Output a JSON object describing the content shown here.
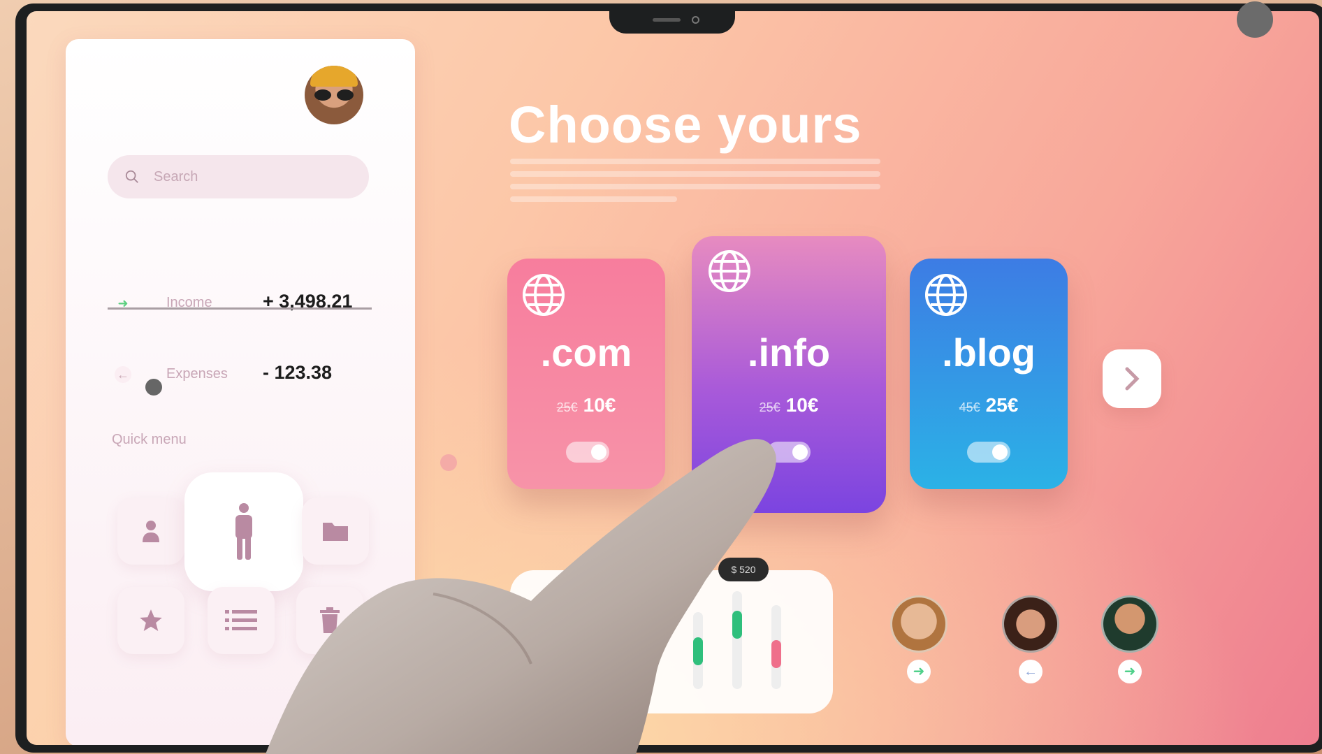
{
  "sidebar": {
    "search_placeholder": "Search",
    "income": {
      "label": "Income",
      "value": "+ 3,498.21"
    },
    "expenses": {
      "label": "Expenses",
      "value": "- 123.38"
    },
    "quick_menu_label": "Quick menu",
    "quick_menu_icons": [
      "user-icon",
      "person-icon",
      "folder-icon",
      "star-icon",
      "list-icon",
      "trash-icon"
    ]
  },
  "main": {
    "title": "Choose yours",
    "domains": [
      {
        "tld": ".com",
        "old_price": "25€",
        "new_price": "10€",
        "enabled": true,
        "color": "#f77a9a"
      },
      {
        "tld": ".info",
        "old_price": "25€",
        "new_price": "10€",
        "enabled": true,
        "color": "#9a4fe0"
      },
      {
        "tld": ".blog",
        "old_price": "45€",
        "new_price": "25€",
        "enabled": true,
        "color": "#2f7be6"
      }
    ],
    "next_icon": "chevron-right-icon",
    "chart_tooltip": "$ 520",
    "people": [
      {
        "arrow": "arrow-right-icon",
        "arrow_color": "#4fd08a"
      },
      {
        "arrow": "arrow-left-icon",
        "arrow_color": "#8fa7d8"
      },
      {
        "arrow": "arrow-right-icon",
        "arrow_color": "#4fd08a"
      }
    ]
  },
  "colors": {
    "income_arrow": "#5bcf7f",
    "expense_arrow": "#c9a7b5",
    "quick_icon": "#b98aa2",
    "bar_green": "#2fbf7c",
    "bar_pink": "#ef6f8b"
  }
}
